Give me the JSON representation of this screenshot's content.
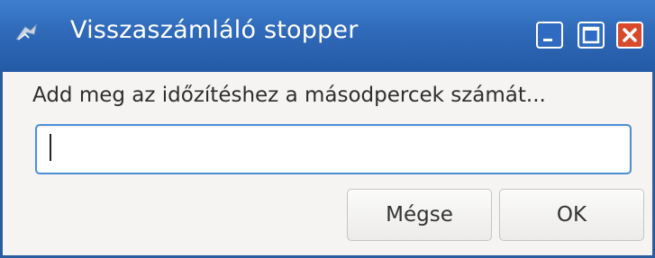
{
  "window": {
    "title": "Visszaszámláló stopper",
    "controls": [
      "minimize-icon",
      "maximize-icon",
      "close-icon"
    ],
    "accent_color": "#2f69b8",
    "close_color": "#d84a2b"
  },
  "dialog": {
    "prompt": "Add meg az időzítéshez a másodpercek számát...",
    "input": {
      "value": "",
      "placeholder": ""
    },
    "buttons": {
      "cancel_label": "Mégse",
      "ok_label": "OK"
    }
  }
}
